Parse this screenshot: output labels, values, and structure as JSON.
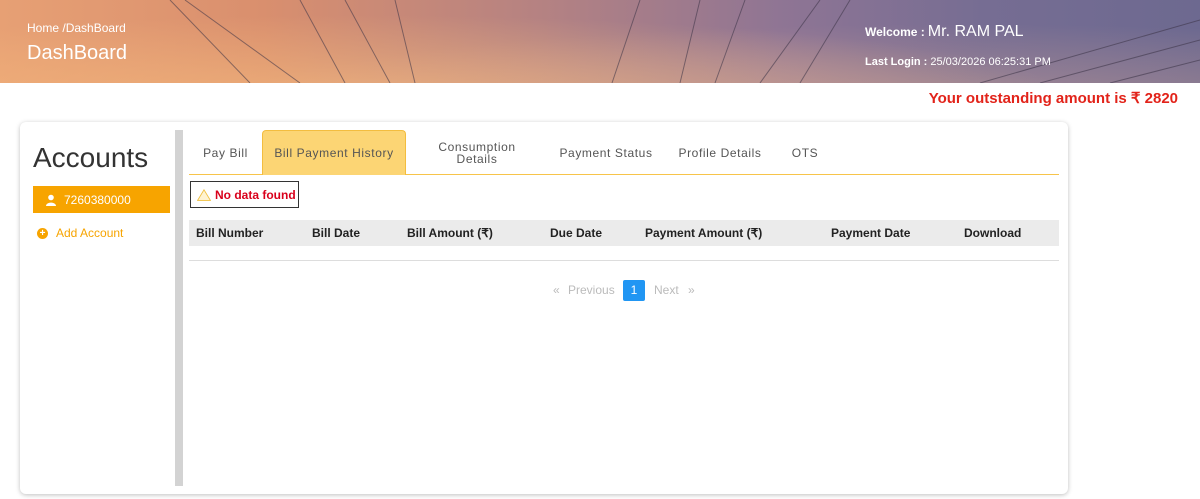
{
  "header": {
    "breadcrumb_home": "Home",
    "breadcrumb_sep": "/",
    "breadcrumb_current": "DashBoard",
    "title": "DashBoard",
    "welcome_label": "Welcome :",
    "user_name": "Mr. RAM PAL",
    "last_login_label": "Last Login :",
    "last_login_value": "25/03/2026 06:25:31 PM"
  },
  "outstanding_text": "Your outstanding amount is ₹ 2820",
  "sidebar": {
    "title": "Accounts",
    "account_number": "7260380000",
    "add_account_label": "Add Account"
  },
  "tabs": [
    {
      "label": "Pay Bill",
      "active": false
    },
    {
      "label": "Bill Payment History",
      "active": true
    },
    {
      "label_line1": "Consumption",
      "label_line2": "Details",
      "active": false
    },
    {
      "label": "Payment Status",
      "active": false
    },
    {
      "label": "Profile Details",
      "active": false
    },
    {
      "label": "OTS",
      "active": false
    }
  ],
  "no_data_text": "No data found",
  "table": {
    "columns": [
      "Bill Number",
      "Bill Date",
      "Bill Amount (₹)",
      "Due Date",
      "Payment Amount (₹)",
      "Payment Date",
      "Download"
    ],
    "rows": []
  },
  "pagination": {
    "prev_arrow": "«",
    "prev_label": "Previous",
    "current_page": "1",
    "next_label": "Next",
    "next_arrow": "»"
  },
  "colors": {
    "accent": "#f7a400",
    "tab_active": "#fcd574",
    "alert_red": "#e2231a",
    "page_active": "#2196f3"
  }
}
